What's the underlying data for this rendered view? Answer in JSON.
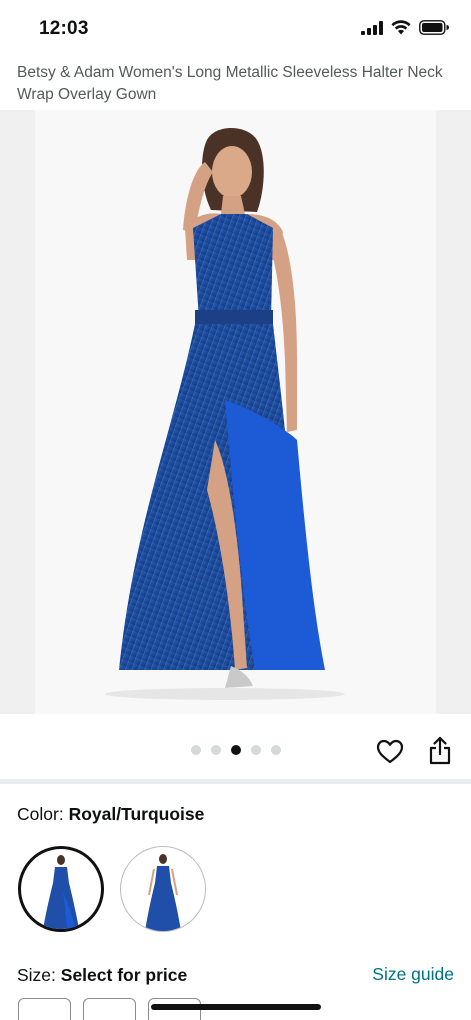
{
  "status_bar": {
    "time": "12:03",
    "icons": [
      "signal-icon",
      "wifi-icon",
      "battery-icon"
    ]
  },
  "product": {
    "title": "Betsy & Adam Women's Long Metallic Sleeveless Halter Neck Wrap Overlay Gown"
  },
  "carousel": {
    "total_images": 5,
    "active_index": 2,
    "actions": [
      "heart-icon",
      "share-icon"
    ]
  },
  "color": {
    "label": "Color:",
    "value": "Royal/Turquoise",
    "swatches": [
      {
        "name": "Royal/Turquoise",
        "selected": true
      },
      {
        "name": "alternate",
        "selected": false
      }
    ]
  },
  "size": {
    "label": "Size:",
    "value": "Select for price",
    "guide_link": "Size guide"
  },
  "colors": {
    "dress_blue": "#1f4fa8",
    "dress_dark": "#16356f",
    "lining_blue": "#1d5bd6",
    "link": "#007185"
  }
}
